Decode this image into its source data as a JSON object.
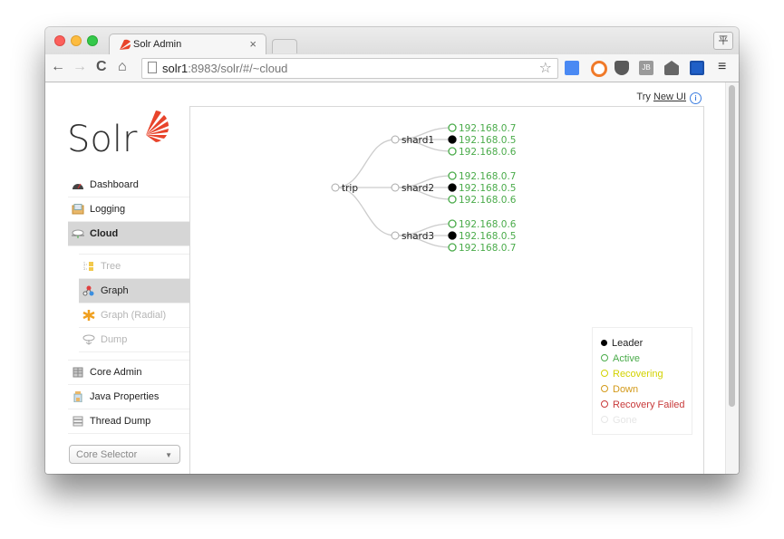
{
  "browser": {
    "tab_title": "Solr Admin",
    "tab_close": "×",
    "profile_button": "平",
    "url_host": "solr1",
    "url_rest": ":8983/solr/#/~cloud",
    "nav": {
      "back": "←",
      "forward": "→",
      "reload": "C",
      "home": "⌂"
    },
    "bookmark_star": "☆",
    "menu_icon": "≡",
    "extensions": [
      "google-translate-icon",
      "orange-circle-icon",
      "pocket-icon",
      "jetbrains-icon",
      "mail-icon",
      "book-icon"
    ],
    "ext_jb_label": "JB"
  },
  "header": {
    "try_prefix": "Try ",
    "try_link": "New UI",
    "info_glyph": "i"
  },
  "logo": {
    "text": "Solr",
    "accent_color": "#e8442b"
  },
  "sidebar": {
    "items": [
      {
        "label": "Dashboard",
        "icon": "dashboard-icon"
      },
      {
        "label": "Logging",
        "icon": "logging-icon"
      },
      {
        "label": "Cloud",
        "icon": "cloud-icon",
        "active": true
      },
      {
        "label": "Core Admin",
        "icon": "core-admin-icon"
      },
      {
        "label": "Java Properties",
        "icon": "java-properties-icon"
      },
      {
        "label": "Thread Dump",
        "icon": "thread-dump-icon"
      }
    ],
    "cloud_submenu": [
      {
        "label": "Tree",
        "icon": "tree-icon"
      },
      {
        "label": "Graph",
        "icon": "graph-icon",
        "active": true
      },
      {
        "label": "Graph (Radial)",
        "icon": "graph-radial-icon"
      },
      {
        "label": "Dump",
        "icon": "dump-icon"
      }
    ],
    "core_selector": {
      "placeholder": "Core Selector",
      "caret": "▼"
    }
  },
  "graph": {
    "collection": "trip",
    "shards": [
      {
        "name": "shard1",
        "replicas": [
          {
            "host": "192.168.0.7",
            "state": "active",
            "leader": false
          },
          {
            "host": "192.168.0.5",
            "state": "active",
            "leader": true
          },
          {
            "host": "192.168.0.6",
            "state": "active",
            "leader": false
          }
        ]
      },
      {
        "name": "shard2",
        "replicas": [
          {
            "host": "192.168.0.7",
            "state": "active",
            "leader": false
          },
          {
            "host": "192.168.0.5",
            "state": "active",
            "leader": true
          },
          {
            "host": "192.168.0.6",
            "state": "active",
            "leader": false
          }
        ]
      },
      {
        "name": "shard3",
        "replicas": [
          {
            "host": "192.168.0.6",
            "state": "active",
            "leader": false
          },
          {
            "host": "192.168.0.5",
            "state": "active",
            "leader": true
          },
          {
            "host": "192.168.0.7",
            "state": "active",
            "leader": false
          }
        ]
      }
    ]
  },
  "legend": {
    "items": [
      {
        "label": "Leader",
        "color": "#000000",
        "filled": true
      },
      {
        "label": "Active",
        "color": "#4aab4a",
        "filled": false
      },
      {
        "label": "Recovering",
        "color": "#d2d200",
        "filled": false
      },
      {
        "label": "Down",
        "color": "#d39a1a",
        "filled": false
      },
      {
        "label": "Recovery Failed",
        "color": "#c83a3a",
        "filled": false
      },
      {
        "label": "Gone",
        "color": "#e6e6e6",
        "filled": false
      }
    ]
  },
  "colors": {
    "active": "#4aab4a",
    "link": "#cccccc",
    "node_stroke": "#aaaaaa"
  }
}
